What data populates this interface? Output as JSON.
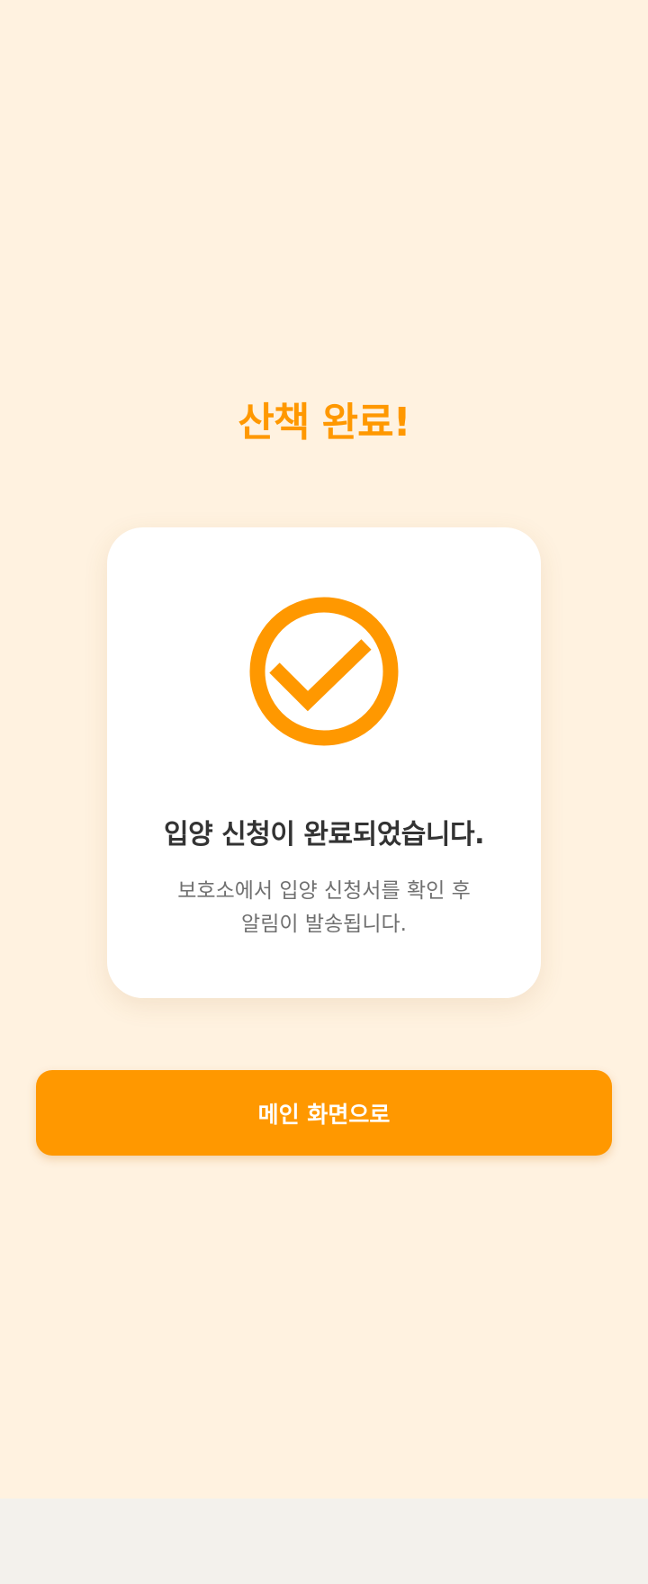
{
  "header": {
    "title": "산책 완료!"
  },
  "card": {
    "icon": "check-circle-icon",
    "heading": "입양 신청이 완료되었습니다.",
    "description_line1": "보호소에서 입양 신청서를 확인 후",
    "description_line2": "알림이 발송됩니다."
  },
  "actions": {
    "main_button_label": "메인 화면으로"
  },
  "colors": {
    "accent": "#ff9800",
    "background": "#fff2e0",
    "card": "#ffffff",
    "heading_text": "#333333",
    "body_text": "#707070"
  }
}
